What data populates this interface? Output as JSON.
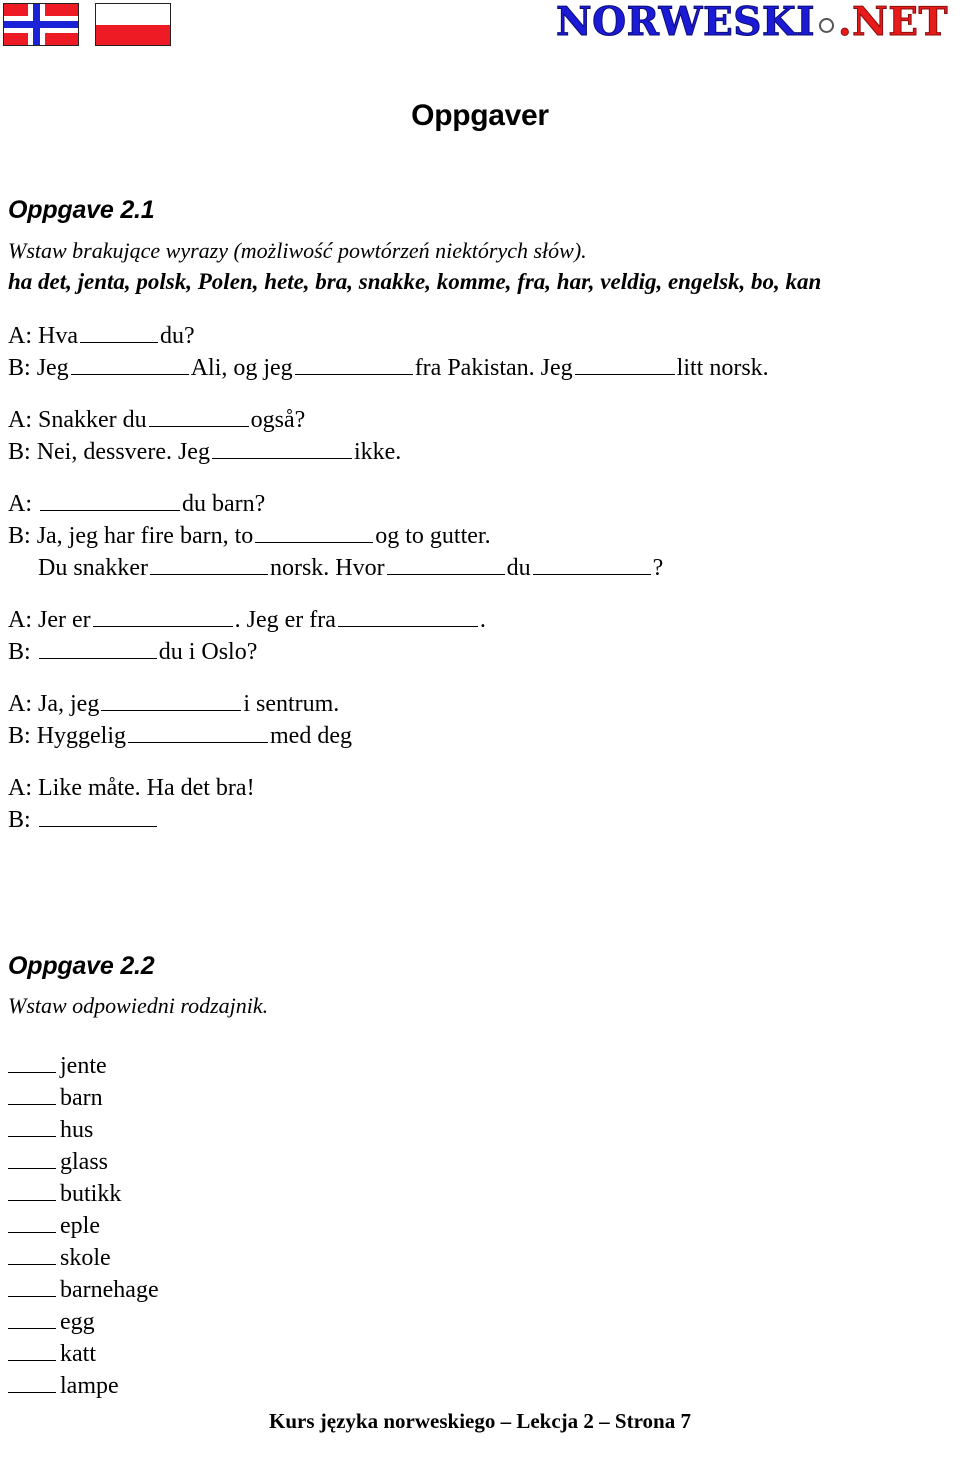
{
  "header": {
    "flag_norway": "norway-flag",
    "flag_poland": "poland-flag",
    "logo_primary": "NORWESKI",
    "logo_secondary": ".NET",
    "colors": {
      "logo_blue": "#1b1bd6",
      "logo_red": "#e81b1b",
      "flag_red": "#ef1b24",
      "flag_blue": "#1a23d6"
    }
  },
  "page_title": "Oppgaver",
  "exercise_1": {
    "heading": "Oppgave 2.1",
    "instruction": "Wstaw brakujące wyrazy (możliwość powtórzeń niektórych słów).",
    "word_bank": "ha det, jenta, polsk, Polen, hete,  bra, snakke, komme, fra, har, veldig, engelsk, bo, kan",
    "dialogue": [
      {
        "speaker": "A:",
        "text_1": "Hva",
        "text_2": "du?"
      },
      {
        "speaker": "B:",
        "text_1": "Jeg",
        "text_2": "Ali, og jeg",
        "text_3": "fra Pakistan. Jeg",
        "text_4": "litt norsk."
      },
      {
        "speaker": "A:",
        "text_1": "Snakker du",
        "text_2": "også?"
      },
      {
        "speaker": "B:",
        "text_1": "Nei, dessvere. Jeg",
        "text_2": "ikke."
      },
      {
        "speaker": "A:",
        "text_1": "",
        "text_2": "du barn?"
      },
      {
        "speaker": "B:",
        "text_1": "Ja, jeg har fire barn, to",
        "text_2": "og to gutter."
      },
      {
        "speaker": "",
        "text_1": "Du snakker",
        "text_2": "norsk. Hvor",
        "text_3": "du",
        "text_4": "?"
      },
      {
        "speaker": "A:",
        "text_1": "Jer er",
        "text_2": ". Jeg er fra",
        "text_3": "."
      },
      {
        "speaker": "B:",
        "text_1": "",
        "text_2": "du i Oslo?"
      },
      {
        "speaker": "A:",
        "text_1": "Ja, jeg",
        "text_2": "i sentrum."
      },
      {
        "speaker": "B:",
        "text_1": "Hyggelig",
        "text_2": "med deg"
      },
      {
        "speaker": "A:",
        "text_1": "Like måte. Ha det bra!"
      },
      {
        "speaker": "B:",
        "text_1": ""
      }
    ]
  },
  "exercise_2": {
    "heading": "Oppgave 2.2",
    "instruction": "Wstaw odpowiedni rodzajnik.",
    "nouns": [
      "jente",
      "barn",
      "hus",
      "glass",
      "butikk",
      "eple",
      "skole",
      "barnehage",
      "egg",
      "katt",
      "lampe"
    ]
  },
  "footer": "Kurs języka norweskiego – Lekcja 2 – Strona 7"
}
